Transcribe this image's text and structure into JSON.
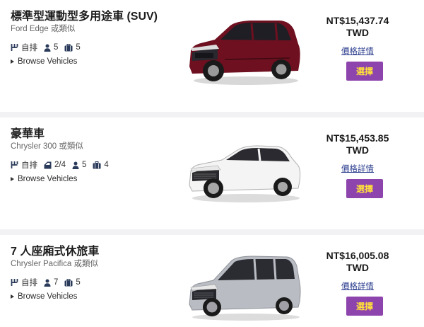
{
  "cars": [
    {
      "title": "標準型運動型多用途車 (SUV)",
      "similar": "Ford Edge 或類似",
      "transmission": "自排",
      "passengers": "5",
      "luggage": "5",
      "browse": "Browse Vehicles",
      "price": "NT$15,437.74",
      "currency": "TWD",
      "details": "價格詳情",
      "select": "選擇",
      "color": "#6e1020"
    },
    {
      "title": "豪華車",
      "similar": "Chrysler 300 或類似",
      "transmission": "自排",
      "doors": "2/4",
      "passengers": "5",
      "luggage": "4",
      "browse": "Browse Vehicles",
      "price": "NT$15,453.85",
      "currency": "TWD",
      "details": "價格詳情",
      "select": "選擇",
      "color": "#f4f4f4"
    },
    {
      "title": "7 人座廂式休旅車",
      "similar": "Chrysler Pacifica 或類似",
      "transmission": "自排",
      "passengers": "7",
      "luggage": "5",
      "browse": "Browse Vehicles",
      "price": "NT$16,005.08",
      "currency": "TWD",
      "details": "價格詳情",
      "select": "選擇",
      "color": "#b9bcc2"
    }
  ],
  "colors": {
    "select_bg": "#8e44ad",
    "select_text": "#ffe13a",
    "link": "#2c3e8f"
  }
}
